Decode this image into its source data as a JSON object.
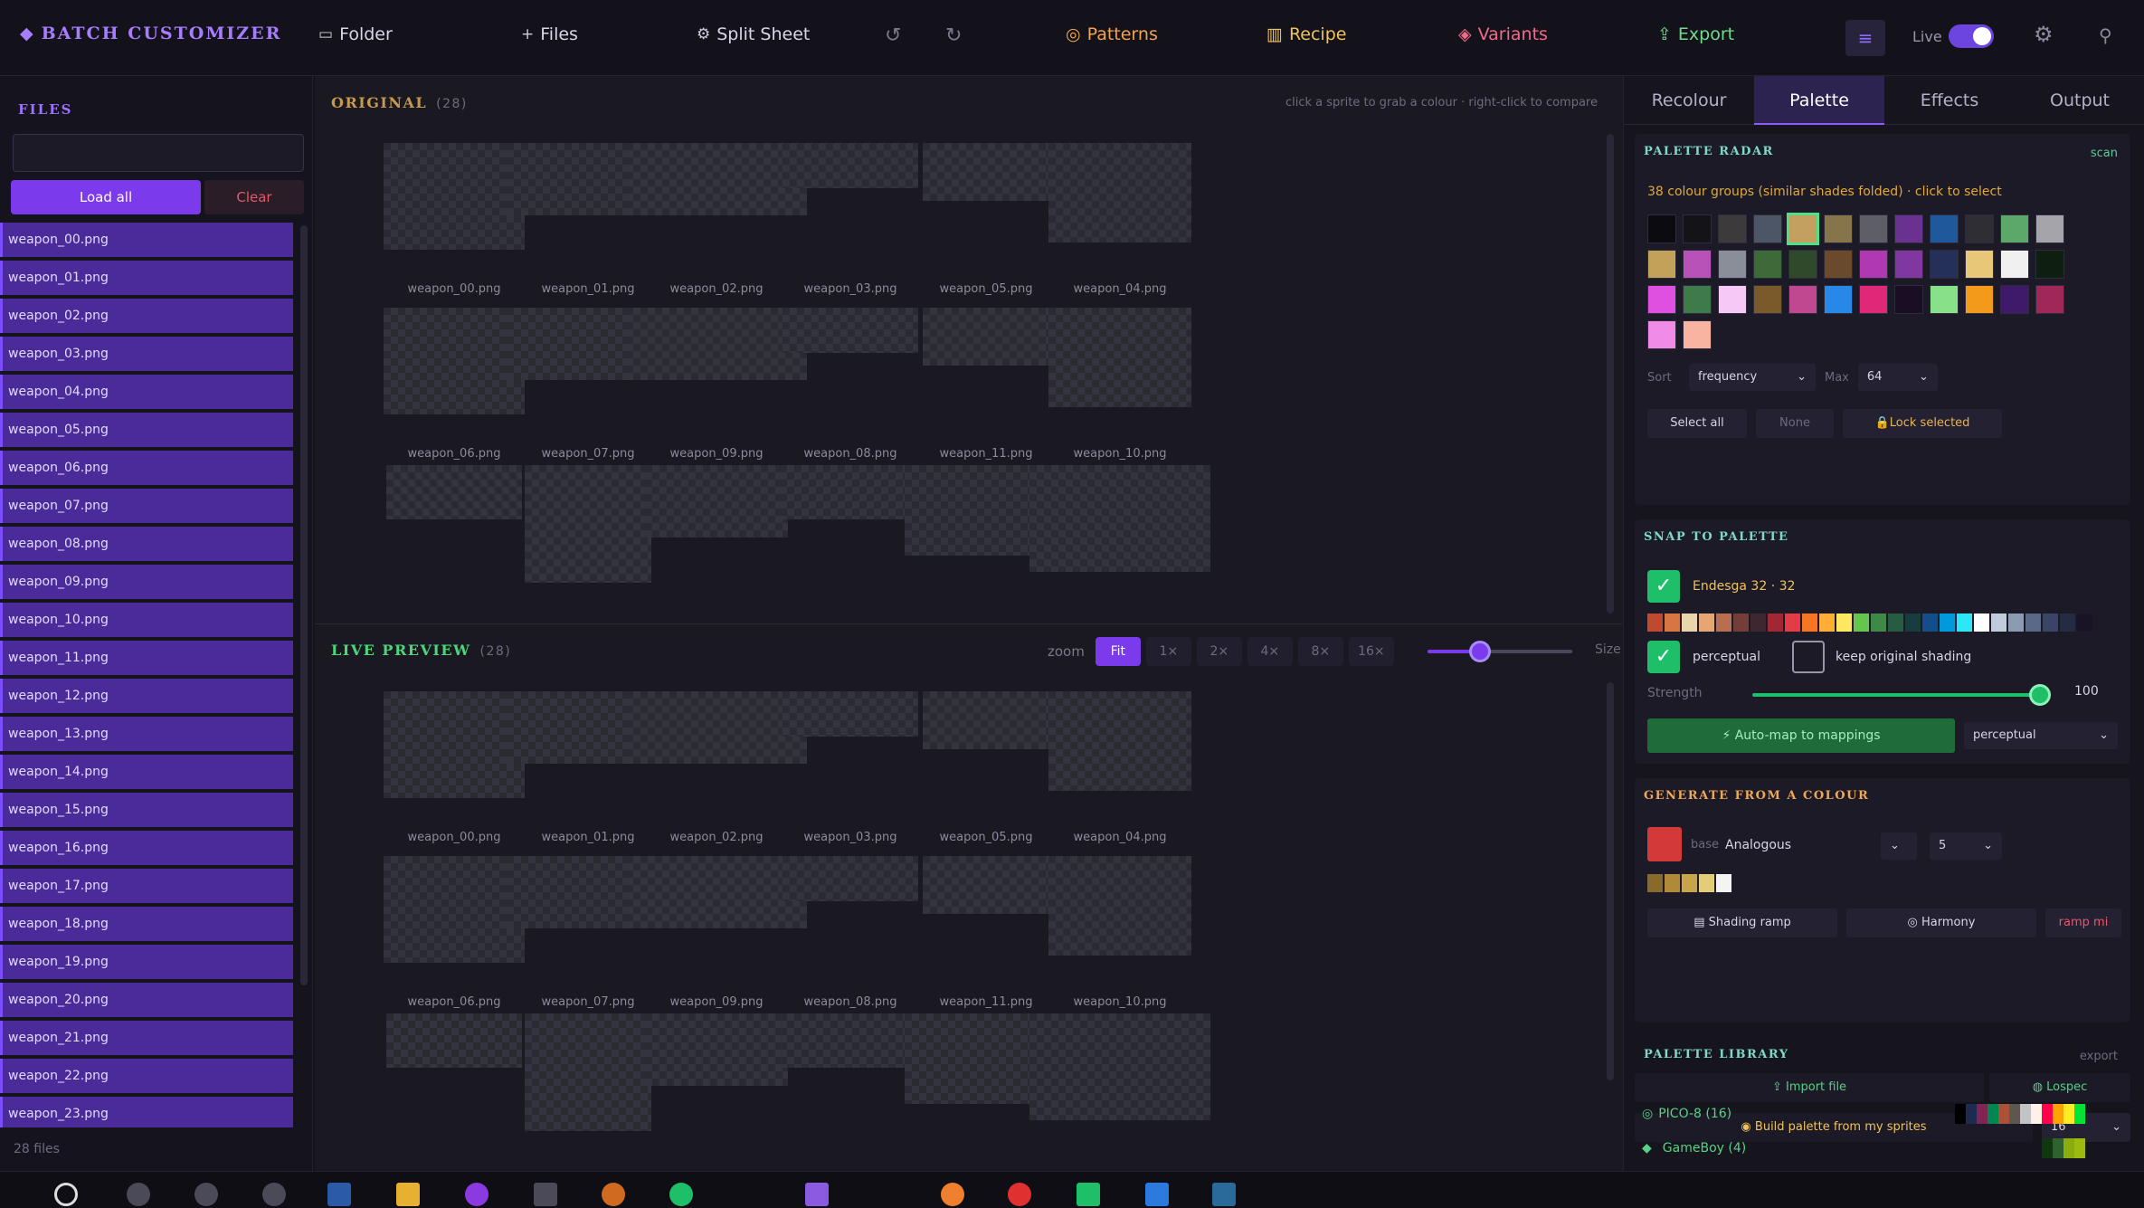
{
  "app": {
    "title": "BATCH CUSTOMIZER"
  },
  "toolbar": {
    "folder": "Folder",
    "files": "Files",
    "split": "Split Sheet",
    "patterns": "Patterns",
    "recipe": "Recipe",
    "variants": "Variants",
    "export": "Export",
    "live": "Live"
  },
  "sidebar": {
    "title": "FILES",
    "load_all": "Load all",
    "clear": "Clear",
    "files_count": "28 files",
    "files": [
      "weapon_00.png",
      "weapon_01.png",
      "weapon_02.png",
      "weapon_03.png",
      "weapon_04.png",
      "weapon_05.png",
      "weapon_06.png",
      "weapon_07.png",
      "weapon_08.png",
      "weapon_09.png",
      "weapon_10.png",
      "weapon_11.png",
      "weapon_12.png",
      "weapon_13.png",
      "weapon_14.png",
      "weapon_15.png",
      "weapon_16.png",
      "weapon_17.png",
      "weapon_18.png",
      "weapon_19.png",
      "weapon_20.png",
      "weapon_21.png",
      "weapon_22.png",
      "weapon_23.png"
    ]
  },
  "original": {
    "title": "ORIGINAL",
    "count": "(28)",
    "hint": "click a sprite to grab a colour · right-click to compare",
    "captions": [
      "weapon_00.png",
      "weapon_01.png",
      "weapon_02.png",
      "weapon_03.png",
      "weapon_05.png",
      "weapon_04.png",
      "weapon_06.png",
      "weapon_07.png",
      "weapon_09.png",
      "weapon_08.png",
      "weapon_11.png",
      "weapon_10.png"
    ]
  },
  "live": {
    "title": "LIVE PREVIEW",
    "count": "(28)",
    "zoom_label": "zoom",
    "zoom_options": [
      "Fit",
      "1×",
      "2×",
      "4×",
      "8×",
      "16×"
    ],
    "size_label": "Size",
    "captions": [
      "weapon_00.png",
      "weapon_01.png",
      "weapon_02.png",
      "weapon_03.png",
      "weapon_05.png",
      "weapon_04.png",
      "weapon_06.png",
      "weapon_07.png",
      "weapon_09.png",
      "weapon_08.png",
      "weapon_11.png",
      "weapon_10.png"
    ]
  },
  "tabs": [
    "Recolour",
    "Palette",
    "Effects",
    "Output"
  ],
  "radar": {
    "title": "PALETTE RADAR",
    "scan": "scan",
    "note": "38 colour groups (similar shades folded) · click to select",
    "swatches": [
      "#0c0c10",
      "#141418",
      "#3c3a3a",
      "#4c5666",
      "#c4a060",
      "#86744a",
      "#5e5e66",
      "#6a3290",
      "#20589c",
      "#2e2e34",
      "#5ca86a",
      "#a4a4aa",
      "#c2a258",
      "#b852b8",
      "#8a8e98",
      "#3e6a3a",
      "#2e4a2a",
      "#6a4a2a",
      "#b038b0",
      "#8038a0",
      "#243058",
      "#e8c878",
      "#f0f0f0",
      "#0e1e10",
      "#e050e0",
      "#3e7a4a",
      "#f6c8f6",
      "#7a5a2a",
      "#c04890",
      "#2888e8",
      "#e02878",
      "#1a0e24",
      "#88e088",
      "#f49a1a",
      "#401a6a",
      "#a02858",
      "#f08ce8",
      "#f8b4a0"
    ],
    "sort_label": "Sort",
    "sort_value": "frequency",
    "max_label": "Max",
    "max_value": "64",
    "select_all": "Select all",
    "none": "None",
    "lock": "Lock selected"
  },
  "snap": {
    "title": "SNAP TO PALETTE",
    "palette": "Endesga 32 · 32",
    "ramp": [
      "#be4a2f",
      "#d77643",
      "#ead4aa",
      "#e4a672",
      "#b86f50",
      "#733e39",
      "#3e2731",
      "#a22633",
      "#e43b44",
      "#f77622",
      "#feae34",
      "#fee761",
      "#63c74d",
      "#3e8948",
      "#265c42",
      "#193c3e",
      "#124e89",
      "#0099db",
      "#2ce8f5",
      "#ffffff",
      "#c0cbdc",
      "#8b9bb4",
      "#5a6988",
      "#3a4466",
      "#262b44",
      "#181425"
    ],
    "perceptual": "perceptual",
    "keep": "keep original shading",
    "strength_label": "Strength",
    "strength": 100,
    "automap": "Auto-map to mappings",
    "mode": "perceptual"
  },
  "generate": {
    "title": "GENERATE FROM A COLOUR",
    "base": "base",
    "scheme": "Analogous",
    "count": "5",
    "base_color": "#d23a3a",
    "gen": [
      "#8a6a2a",
      "#b08a3a",
      "#c8a44a",
      "#e4cc78",
      "#f4f4f4"
    ],
    "shading": "Shading ramp",
    "harmony": "Harmony",
    "rampmi": "ramp mi"
  },
  "library": {
    "title": "PALETTE LIBRARY",
    "export": "export",
    "import": "Import file",
    "lospec": "Lospec",
    "build": "Build palette from my sprites",
    "build_count": "16",
    "pico": "PICO-8 (16)",
    "gameboy": "GameBoy (4)",
    "pico_colors": [
      "#000000",
      "#1d2b53",
      "#7e2553",
      "#008751",
      "#ab5236",
      "#5f574f",
      "#c2c3c7",
      "#fff1e8",
      "#ff004d",
      "#ffa300",
      "#ffec27",
      "#00e436"
    ],
    "gb_colors": [
      "#0f380f",
      "#306230",
      "#8bac0f",
      "#9bbc0f"
    ]
  }
}
